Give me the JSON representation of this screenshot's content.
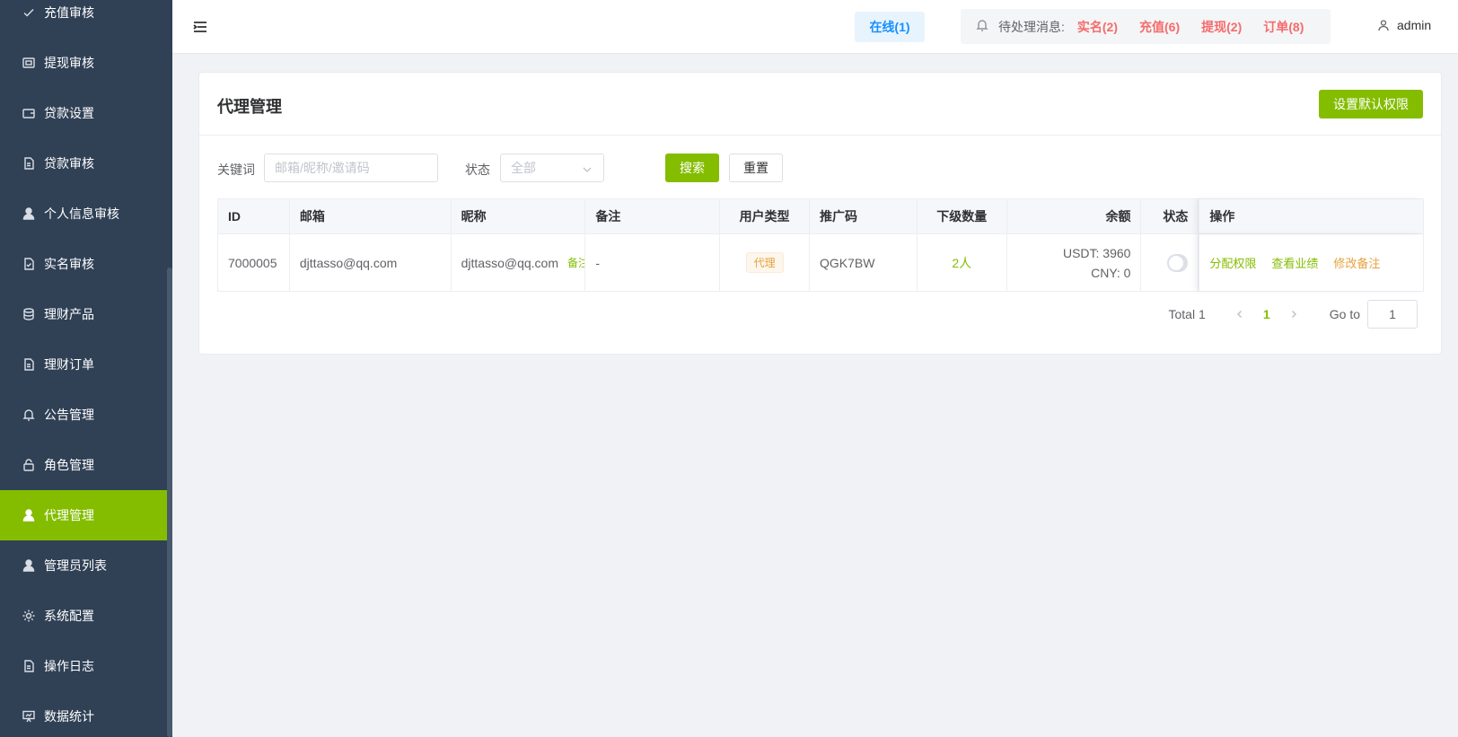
{
  "sidebar": {
    "items": [
      {
        "label": "充值审核",
        "icon": "check-icon",
        "active": false
      },
      {
        "label": "提现审核",
        "icon": "wallet-icon",
        "active": false
      },
      {
        "label": "贷款设置",
        "icon": "briefcase-icon",
        "active": false
      },
      {
        "label": "贷款审核",
        "icon": "document-icon",
        "active": false
      },
      {
        "label": "个人信息审核",
        "icon": "user-icon",
        "active": false
      },
      {
        "label": "实名审核",
        "icon": "document-check-icon",
        "active": false
      },
      {
        "label": "理财产品",
        "icon": "coins-icon",
        "active": false
      },
      {
        "label": "理财订单",
        "icon": "document-icon",
        "active": false
      },
      {
        "label": "公告管理",
        "icon": "bell-icon",
        "active": false
      },
      {
        "label": "角色管理",
        "icon": "lock-icon",
        "active": false
      },
      {
        "label": "代理管理",
        "icon": "user-icon",
        "active": true
      },
      {
        "label": "管理员列表",
        "icon": "user-icon",
        "active": false
      },
      {
        "label": "系统配置",
        "icon": "gear-icon",
        "active": false
      },
      {
        "label": "操作日志",
        "icon": "document-icon",
        "active": false
      },
      {
        "label": "数据统计",
        "icon": "chart-board-icon",
        "active": false
      }
    ]
  },
  "header": {
    "online_label": "在线(1)",
    "pending_label": "待处理消息:",
    "pending": [
      {
        "label": "实名(2)"
      },
      {
        "label": "充值(6)"
      },
      {
        "label": "提现(2)"
      },
      {
        "label": "订单(8)"
      }
    ],
    "user": "admin"
  },
  "page": {
    "title": "代理管理",
    "default_perm_button": "设置默认权限"
  },
  "filters": {
    "keyword_label": "关键词",
    "keyword_placeholder": "邮箱/昵称/邀请码",
    "status_label": "状态",
    "status_value": "全部",
    "search_button": "搜索",
    "reset_button": "重置"
  },
  "table": {
    "columns": [
      "ID",
      "邮箱",
      "昵称",
      "备注",
      "用户类型",
      "推广码",
      "下级数量",
      "余额",
      "状态",
      "操作"
    ],
    "rows": [
      {
        "id": "7000005",
        "email": "djttasso@qq.com",
        "nickname": "djttasso@qq.com",
        "nickname_note_link": "备注",
        "note": "-",
        "user_type": "代理",
        "promo_code": "QGK7BW",
        "sub_count": "2人",
        "balance_usdt": "USDT: 3960",
        "balance_cny": "CNY: 0",
        "status_on": false,
        "ops": [
          "分配权限",
          "查看业绩",
          "修改备注"
        ]
      }
    ]
  },
  "pagination": {
    "total": "Total 1",
    "current_page": "1",
    "goto_label": "Go to",
    "goto_value": "1"
  },
  "colors": {
    "sidebar_bg": "#304156",
    "accent": "#84bd00",
    "danger": "#f56c6c",
    "warning": "#e6a23c",
    "online_blue": "#1890ff"
  }
}
